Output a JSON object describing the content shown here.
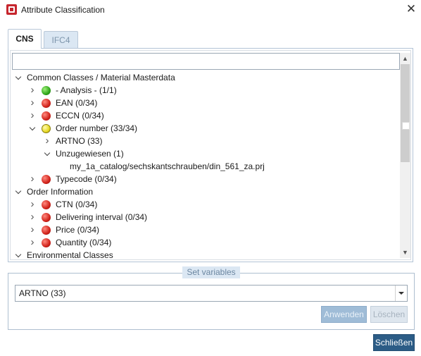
{
  "window": {
    "title": "Attribute Classification",
    "close_glyph": "✕"
  },
  "tabs": [
    {
      "label": "CNS",
      "active": true
    },
    {
      "label": "IFC4",
      "active": false
    }
  ],
  "filter": {
    "value": "",
    "placeholder": ""
  },
  "tree": [
    {
      "label": "Common Classes / Material Masterdata",
      "expander": "expanded",
      "status": null
    },
    {
      "label": "- Analysis - (1/1)",
      "expander": "collapsed",
      "status": "green"
    },
    {
      "label": "EAN (0/34)",
      "expander": "collapsed",
      "status": "red"
    },
    {
      "label": "ECCN (0/34)",
      "expander": "collapsed",
      "status": "red"
    },
    {
      "label": "Order number (33/34)",
      "expander": "expanded",
      "status": "yellow"
    },
    {
      "label": "ARTNO (33)",
      "expander": "collapsed",
      "status": null
    },
    {
      "label": "Unzugewiesen (1)",
      "expander": "expanded",
      "status": null
    },
    {
      "label": "my_1a_catalog/sechskantschrauben/din_561_za.prj",
      "expander": null,
      "status": null
    },
    {
      "label": "Typecode (0/34)",
      "expander": "collapsed",
      "status": "red"
    },
    {
      "label": "Order Information",
      "expander": "expanded",
      "status": null
    },
    {
      "label": "CTN (0/34)",
      "expander": "collapsed",
      "status": "red"
    },
    {
      "label": "Delivering interval (0/34)",
      "expander": "collapsed",
      "status": "red"
    },
    {
      "label": "Price (0/34)",
      "expander": "collapsed",
      "status": "red"
    },
    {
      "label": "Quantity (0/34)",
      "expander": "collapsed",
      "status": "red"
    },
    {
      "label": "Environmental Classes",
      "expander": "expanded",
      "status": null
    }
  ],
  "status_colors": {
    "green": "#2fa51a",
    "red": "#d1221a",
    "yellow": "#e8da26"
  },
  "set_variables": {
    "title": "Set variables",
    "selected": "ARTNO (33)",
    "apply_label": "Anwenden",
    "delete_label": "Löschen"
  },
  "footer": {
    "close_label": "Schließen"
  },
  "colors": {
    "accent": "#2c5c86",
    "tab_inactive": "#dbe7f3",
    "border": "#aebfd0"
  }
}
